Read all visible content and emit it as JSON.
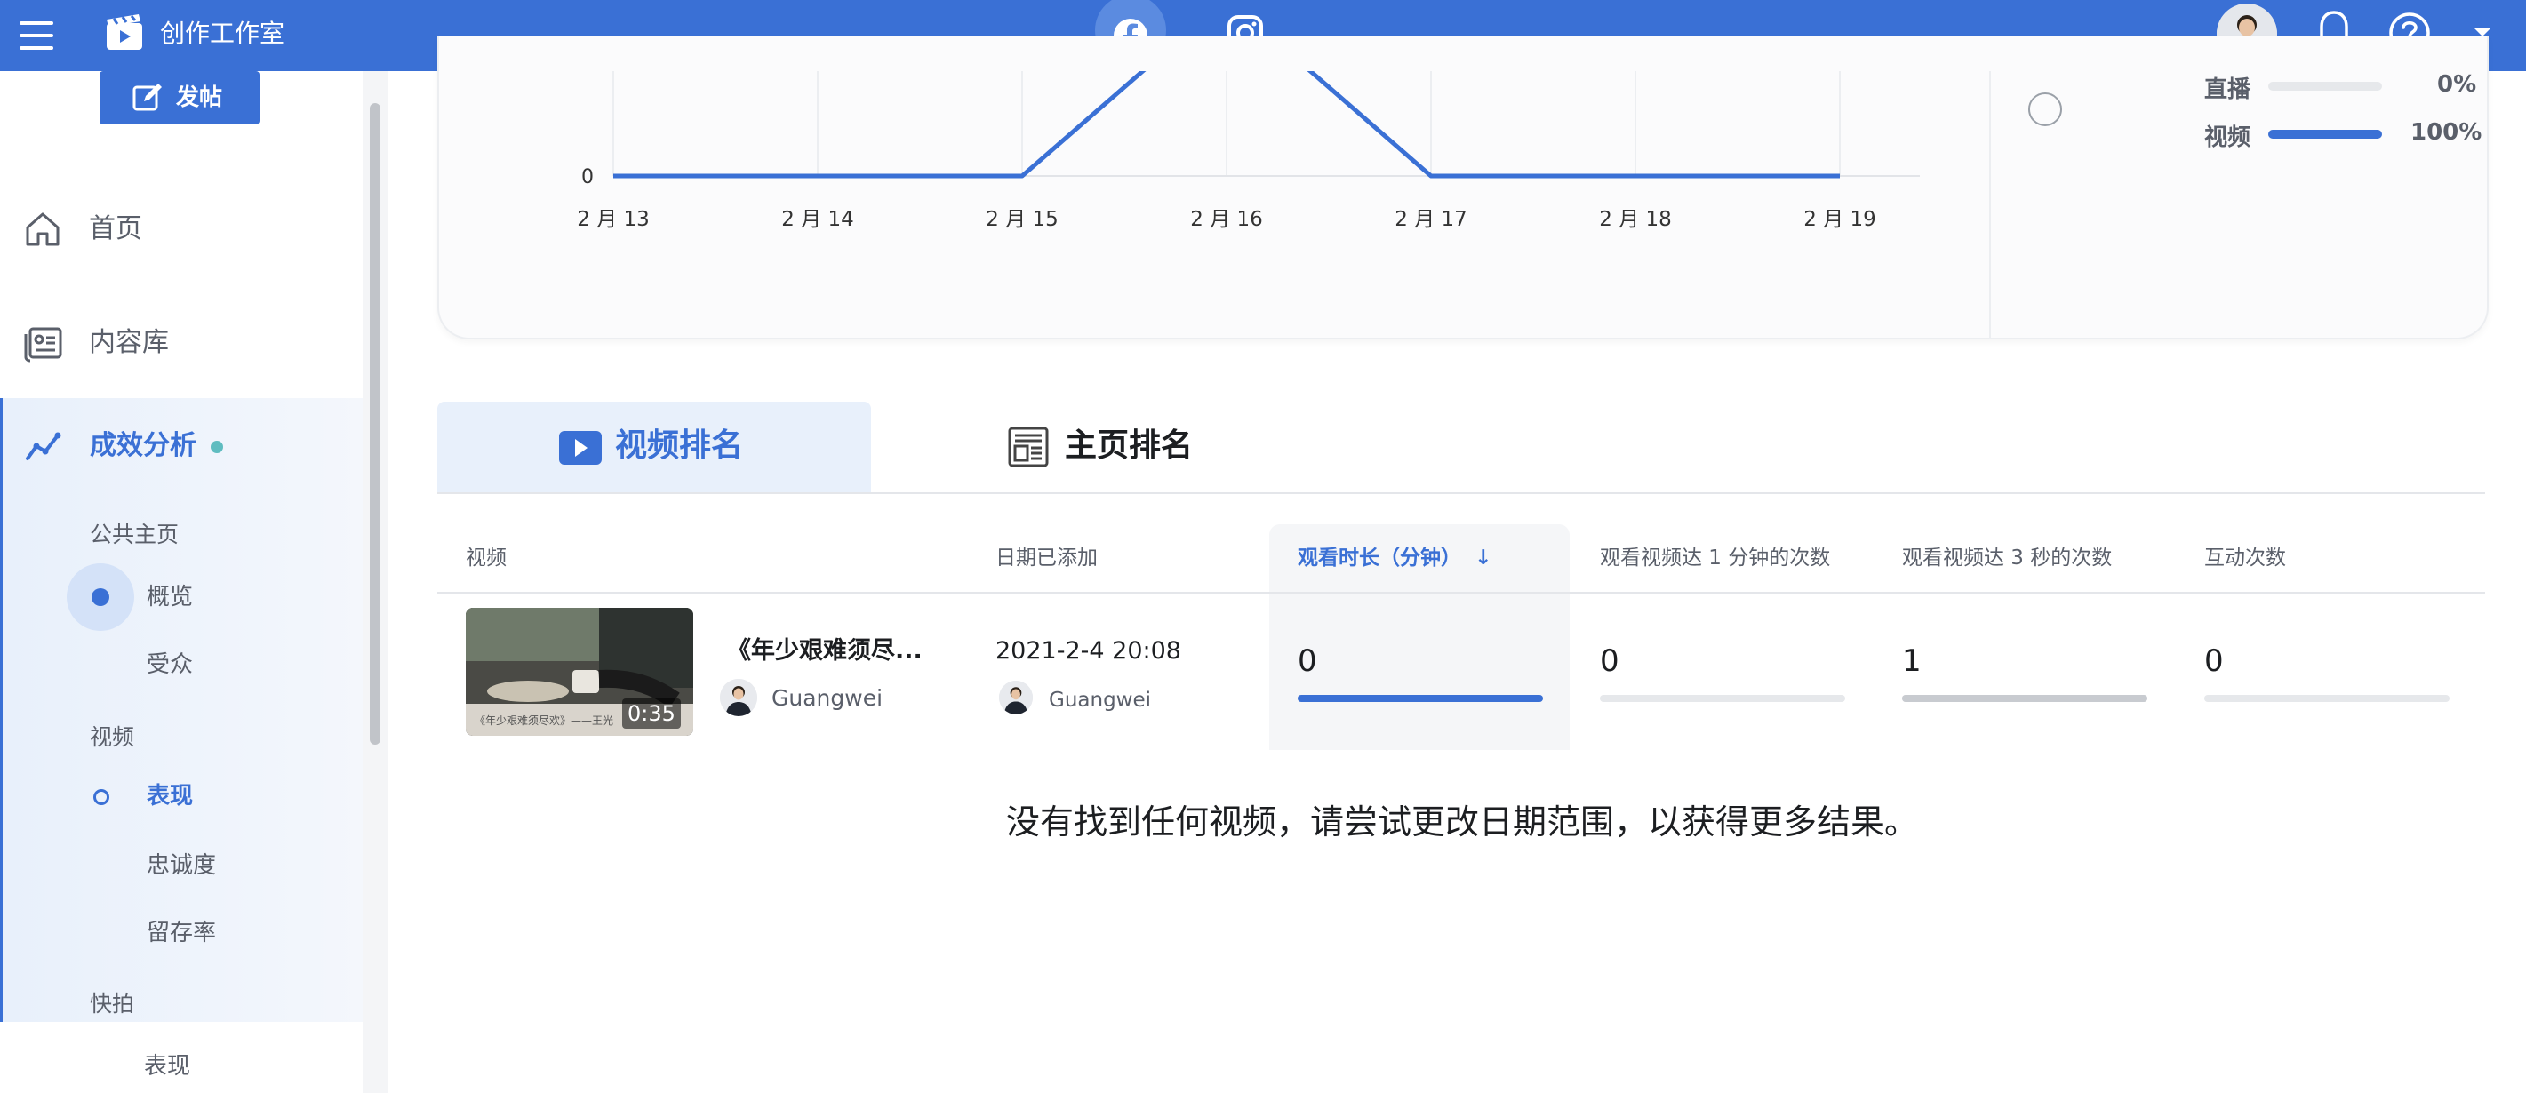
{
  "topbar": {
    "title": "创作工作室",
    "icons": [
      "menu-icon",
      "clapperboard-icon",
      "facebook-icon",
      "instagram-icon",
      "avatar",
      "bell-icon",
      "help-icon",
      "caret-down-icon"
    ],
    "accent": "#3a70d5"
  },
  "sidebar": {
    "post_button": "发帖",
    "items": [
      {
        "label": "首页",
        "icon": "home-icon"
      },
      {
        "label": "内容库",
        "icon": "library-icon"
      },
      {
        "label": "成效分析",
        "icon": "analytics-icon",
        "active": true
      }
    ],
    "sections": [
      {
        "label": "公共主页",
        "items": [
          "概览",
          "受众"
        ]
      },
      {
        "label": "视频",
        "items": [
          "表现",
          "忠诚度",
          "留存率"
        ]
      },
      {
        "label": "快拍",
        "items": [
          "表现"
        ]
      }
    ]
  },
  "chart_data": {
    "type": "line",
    "x": [
      "2 月 13",
      "2 月 14",
      "2 月 15",
      "2 月 16",
      "2 月 17",
      "2 月 18",
      "2 月 19"
    ],
    "series": [
      {
        "values": [
          0,
          0,
          0,
          1,
          0,
          0,
          0
        ]
      }
    ],
    "yticks": [
      "0"
    ],
    "legend": [
      {
        "label": "直播",
        "percent": "0%",
        "fraction": 0
      },
      {
        "label": "视频",
        "percent": "100%",
        "fraction": 1
      }
    ]
  },
  "tabs": [
    {
      "label": "视频排名",
      "icon": "video-play-icon",
      "active": true
    },
    {
      "label": "主页排名",
      "icon": "newspaper-icon",
      "active": false
    }
  ],
  "table": {
    "headers": [
      "视频",
      "日期已添加",
      "观看时长（分钟）",
      "观看视频达 1 分钟的次数",
      "观看视频达 3 秒的次数",
      "互动次数"
    ],
    "sort_arrow": "↓",
    "rows": [
      {
        "title": "《年少艰难须尽...",
        "owner": "Guangwei",
        "duration": "0:35",
        "thumb_caption": "《年少艰难须尽欢》——王光",
        "date": "2021-2-4 20:08",
        "date_owner": "Guangwei",
        "metrics": [
          {
            "value": "0",
            "fill": 1.0,
            "color": "#3a70d5"
          },
          {
            "value": "0",
            "fill": 0,
            "color": "#e6e8eb"
          },
          {
            "value": "1",
            "fill": 1.0,
            "color": "#c8cbd0"
          },
          {
            "value": "0",
            "fill": 0,
            "color": "#e6e8eb"
          }
        ]
      }
    ],
    "empty_message": "没有找到任何视频，请尝试更改日期范围，以获得更多结果。"
  }
}
